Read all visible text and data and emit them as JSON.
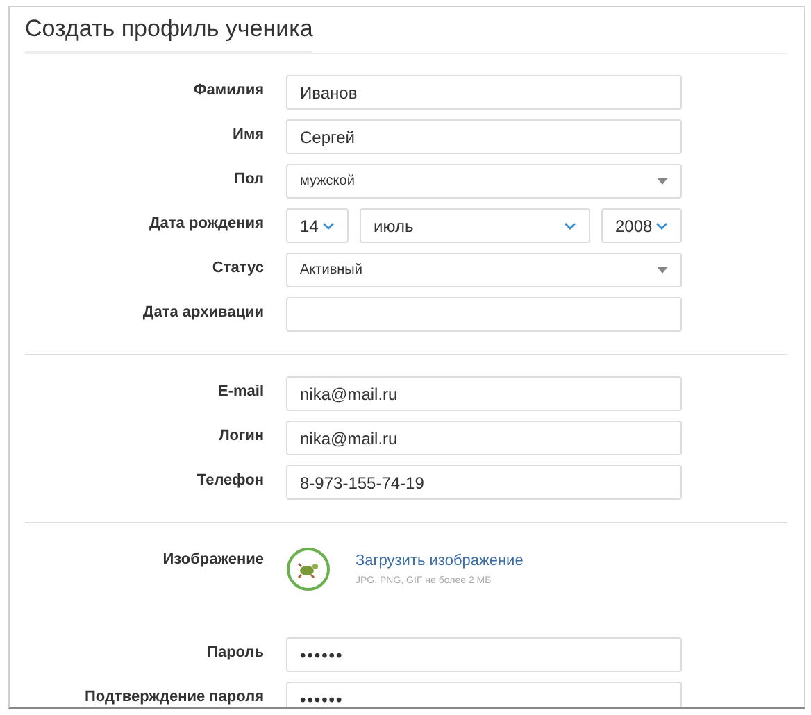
{
  "title": "Создать профиль ученика",
  "sections": [
    {
      "rows": [
        {
          "kind": "text",
          "label": "Фамилия",
          "value": "Иванов"
        },
        {
          "kind": "text",
          "label": "Имя",
          "value": "Сергей"
        },
        {
          "kind": "select",
          "label": "Пол",
          "value": "мужской"
        },
        {
          "kind": "date",
          "label": "Дата рождения",
          "parts": [
            "14",
            "июль",
            "2008"
          ]
        },
        {
          "kind": "select",
          "label": "Статус",
          "value": "Активный"
        },
        {
          "kind": "text",
          "label": "Дата архивации"
        }
      ]
    },
    {
      "rows": [
        {
          "kind": "text",
          "label": "E-mail",
          "value": "nika@mail.ru"
        },
        {
          "kind": "text",
          "label": "Логин",
          "value": "nika@mail.ru"
        },
        {
          "kind": "text",
          "label": "Телефон",
          "value": "8-973-155-74-19"
        }
      ]
    },
    {
      "rows": [
        {
          "kind": "image",
          "label": "Изображение",
          "link": "Загрузить изображение",
          "hint": "JPG, PNG, GIF не более 2 МБ"
        },
        {
          "kind": "password",
          "label": "Пароль",
          "value": "••••••"
        },
        {
          "kind": "password",
          "label": "Подтверждение пароля",
          "value": "••••••"
        }
      ]
    }
  ]
}
